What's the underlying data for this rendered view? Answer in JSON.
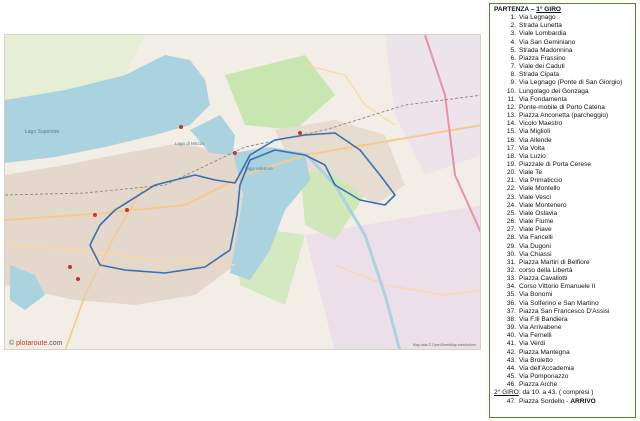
{
  "map": {
    "labels": {
      "lake_top_left": "Lago Superiore",
      "lake_middle": "Lago di Mezzo",
      "lake_bottom": "Lago Inferiore"
    },
    "credit_prefix": "© ",
    "credit_brand": "plotaroute",
    "credit_suffix": ".com",
    "osm_credit": "Map data © OpenStreetMap contributors"
  },
  "route": {
    "title_prefix": "PARTENZA – ",
    "title_lap": "1° GIRO",
    "stops": [
      {
        "n": "1.",
        "name": "Via Legnago"
      },
      {
        "n": "2.",
        "name": "Strada Lunetta"
      },
      {
        "n": "3.",
        "name": "Viale Lombardia"
      },
      {
        "n": "4.",
        "name": "Via San Geminiano"
      },
      {
        "n": "5.",
        "name": "Strada Madonnina"
      },
      {
        "n": "6.",
        "name": "Piazza Frassino"
      },
      {
        "n": "7.",
        "name": "Viale dei Caduti"
      },
      {
        "n": "8.",
        "name": "Strada Cipata"
      },
      {
        "n": "9.",
        "name": "Via Legnago (Ponte di San Giorgio)"
      },
      {
        "n": "10.",
        "name": "Lungolago dei Gonzaga"
      },
      {
        "n": "11.",
        "name": "Via Fondamenta"
      },
      {
        "n": "12.",
        "name": "Ponte-mobile di Porto Catena"
      },
      {
        "n": "13.",
        "name": "Piazza Anconetta (parcheggio)"
      },
      {
        "n": "14.",
        "name": "Vicolo Maestro"
      },
      {
        "n": "15.",
        "name": "Via Miglioli"
      },
      {
        "n": "16.",
        "name": "Via Allende"
      },
      {
        "n": "17.",
        "name": "Via Volta"
      },
      {
        "n": "18.",
        "name": "Via Luzio"
      },
      {
        "n": "19.",
        "name": "Piazzale di Porta Cerese"
      },
      {
        "n": "20.",
        "name": "Viale Te"
      },
      {
        "n": "21.",
        "name": "Via Primaticcio"
      },
      {
        "n": "22.",
        "name": "Viale Montello"
      },
      {
        "n": "23.",
        "name": "Viale Vesci"
      },
      {
        "n": "24.",
        "name": "Viale Montenero"
      },
      {
        "n": "25.",
        "name": "Viale Oslavia"
      },
      {
        "n": "26.",
        "name": "Viale Fiume"
      },
      {
        "n": "27.",
        "name": "Viale Piave"
      },
      {
        "n": "28.",
        "name": "Via Fancelli"
      },
      {
        "n": "29.",
        "name": "Via Dugoni"
      },
      {
        "n": "30.",
        "name": "Via Chiassi"
      },
      {
        "n": "31.",
        "name": "Piazza Martiri di Belfiore"
      },
      {
        "n": "32.",
        "name": "corso della Libertà"
      },
      {
        "n": "33.",
        "name": "Piazza Cavallotti"
      },
      {
        "n": "34.",
        "name": "Corso Vittorio Emanuele II"
      },
      {
        "n": "35.",
        "name": "Via Bonomi"
      },
      {
        "n": "36.",
        "name": "Via Solferino e San Martino"
      },
      {
        "n": "37.",
        "name": "Piazza San Francesco D'Assisi"
      },
      {
        "n": "38.",
        "name": "Via F.lli Bandiera"
      },
      {
        "n": "39.",
        "name": "Via Arrivabene"
      },
      {
        "n": "40.",
        "name": "Via Fernelli"
      },
      {
        "n": "41.",
        "name": "Via Verdi"
      },
      {
        "n": "42.",
        "name": "Piazza Mantegna"
      },
      {
        "n": "43.",
        "name": "Via Broletto"
      },
      {
        "n": "44.",
        "name": "Via dell'Accademia"
      },
      {
        "n": "45.",
        "name": "Via Pomponazzo"
      },
      {
        "n": "46.",
        "name": "Piazza Arche"
      }
    ],
    "second_lap_label": "2° GIRO",
    "second_lap_text": ": da 10.  a 43. ( compresi )",
    "final_n": "47.",
    "final_name": "Piazza Sordello - ",
    "final_bold": "ARRIVO"
  },
  "colors": {
    "lake": "#aad3df",
    "route": "#3a6fb0",
    "park": "#c8e6b0",
    "panel_border": "#4f8a2c"
  }
}
